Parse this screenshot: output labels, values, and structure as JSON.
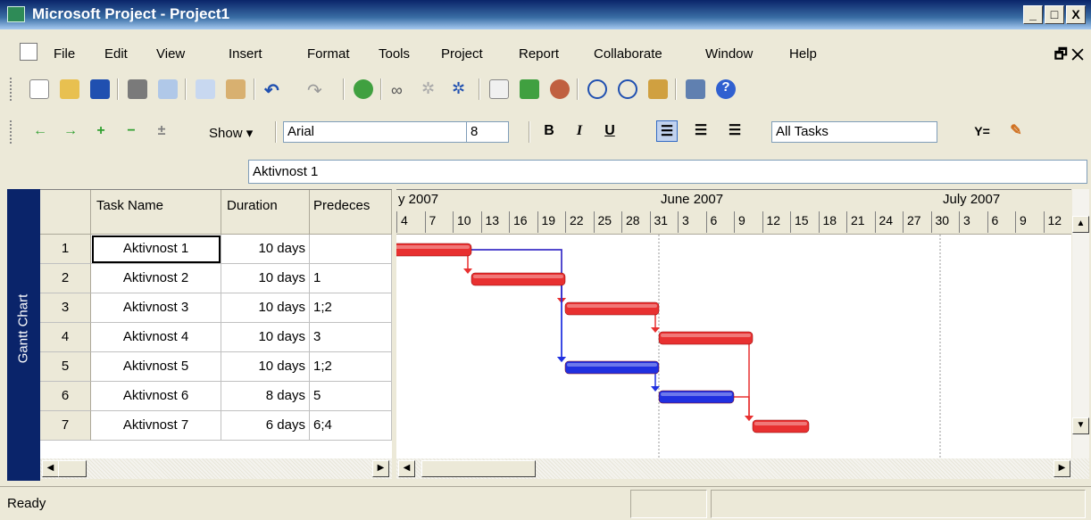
{
  "window": {
    "title": "Microsoft Project - Project1",
    "min": "_",
    "max": "□",
    "close": "X"
  },
  "menu": [
    "File",
    "Edit",
    "View",
    "Insert",
    "Format",
    "Tools",
    "Project",
    "Report",
    "Collaborate",
    "Window",
    "Help"
  ],
  "toolbar2": {
    "show_label": "Show ▾",
    "font": "Arial",
    "size": "8",
    "bold": "B",
    "italic": "I",
    "underline": "U",
    "filter": "All Tasks"
  },
  "entry_value": "Aktivnost 1",
  "view_bar_label": "Gantt Chart",
  "columns": {
    "name": "Task Name",
    "duration": "Duration",
    "pred": "Predeces"
  },
  "tasks": [
    {
      "id": "1",
      "name": "Aktivnost 1",
      "duration": "10 days",
      "pred": "",
      "color": "#e83030"
    },
    {
      "id": "2",
      "name": "Aktivnost 2",
      "duration": "10 days",
      "pred": "1",
      "color": "#e83030"
    },
    {
      "id": "3",
      "name": "Aktivnost 3",
      "duration": "10 days",
      "pred": "1;2",
      "color": "#e83030"
    },
    {
      "id": "4",
      "name": "Aktivnost 4",
      "duration": "10 days",
      "pred": "3",
      "color": "#e83030"
    },
    {
      "id": "5",
      "name": "Aktivnost 5",
      "duration": "10 days",
      "pred": "1;2",
      "color": "#2030e0"
    },
    {
      "id": "6",
      "name": "Aktivnost 6",
      "duration": "8 days",
      "pred": "5",
      "color": "#2030e0"
    },
    {
      "id": "7",
      "name": "Aktivnost 7",
      "duration": "6 days",
      "pred": "6;4",
      "color": "#e83030"
    }
  ],
  "timescale": {
    "months": [
      "y 2007",
      "June 2007",
      "July 2007"
    ],
    "days": [
      "4",
      "7",
      "10",
      "13",
      "16",
      "19",
      "22",
      "25",
      "28",
      "31",
      "3",
      "6",
      "9",
      "12",
      "15",
      "18",
      "21",
      "24",
      "27",
      "30",
      "3",
      "6",
      "9",
      "12"
    ]
  },
  "status_text": "Ready",
  "colors": {
    "critical": "#e83030",
    "noncritical": "#2030e0",
    "titlebar": "#0a246a"
  }
}
